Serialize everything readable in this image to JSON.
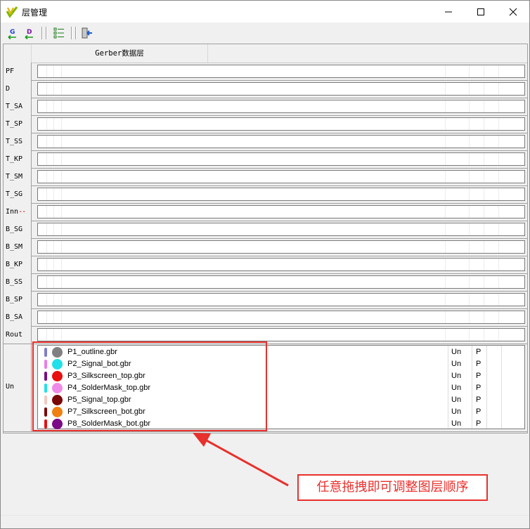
{
  "window": {
    "title": "层管理"
  },
  "toolbar": {
    "buttons": [
      {
        "name": "g-layer-button",
        "glyph": "G"
      },
      {
        "name": "d-layer-button",
        "glyph": "D"
      },
      {
        "name": "layer-list-button",
        "glyph": ""
      },
      {
        "name": "exit-button",
        "glyph": ""
      }
    ]
  },
  "grid": {
    "header": {
      "gerber_column": "Gerber数据层"
    },
    "rows": [
      {
        "label": "PF"
      },
      {
        "label": "D"
      },
      {
        "label": "T_SA"
      },
      {
        "label": "T_SP"
      },
      {
        "label": "T_SS"
      },
      {
        "label": "T_KP"
      },
      {
        "label": "T_SM"
      },
      {
        "label": "T_SG"
      },
      {
        "label": "Inn",
        "suffix": "--"
      },
      {
        "label": "B_SG"
      },
      {
        "label": "B_SM"
      },
      {
        "label": "B_KP"
      },
      {
        "label": "B_SS"
      },
      {
        "label": "B_SP"
      },
      {
        "label": "B_SA"
      },
      {
        "label": "Rout"
      }
    ],
    "unassigned": {
      "label": "Un",
      "files": [
        {
          "name": "P1_outline.gbr",
          "bar_color": "#7f7fc8",
          "dot_color": "#808080",
          "type": "Un",
          "flag": "P"
        },
        {
          "name": "P2_Signal_bot.gbr",
          "bar_color": "#e87fe8",
          "dot_color": "#22e0e8",
          "type": "Un",
          "flag": "P"
        },
        {
          "name": "P3_Silkscreen_top.gbr",
          "bar_color": "#7b0a86",
          "dot_color": "#e81010",
          "type": "Un",
          "flag": "P"
        },
        {
          "name": "P4_SolderMask_top.gbr",
          "bar_color": "#22e0e8",
          "dot_color": "#f08ae8",
          "type": "Un",
          "flag": "P"
        },
        {
          "name": "P5_Signal_top.gbr",
          "bar_color": "#f3c8c0",
          "dot_color": "#7a0808",
          "type": "Un",
          "flag": "P"
        },
        {
          "name": "P7_Silkscreen_bot.gbr",
          "bar_color": "#7a0808",
          "dot_color": "#f08010",
          "type": "Un",
          "flag": "P"
        },
        {
          "name": "P8_SolderMask_bot.gbr",
          "bar_color": "#e81010",
          "dot_color": "#7b0a86",
          "type": "Un",
          "flag": "P"
        }
      ]
    }
  },
  "annotation": {
    "text": "任意拖拽即可调整图层顺序",
    "color": "#e8302c"
  }
}
